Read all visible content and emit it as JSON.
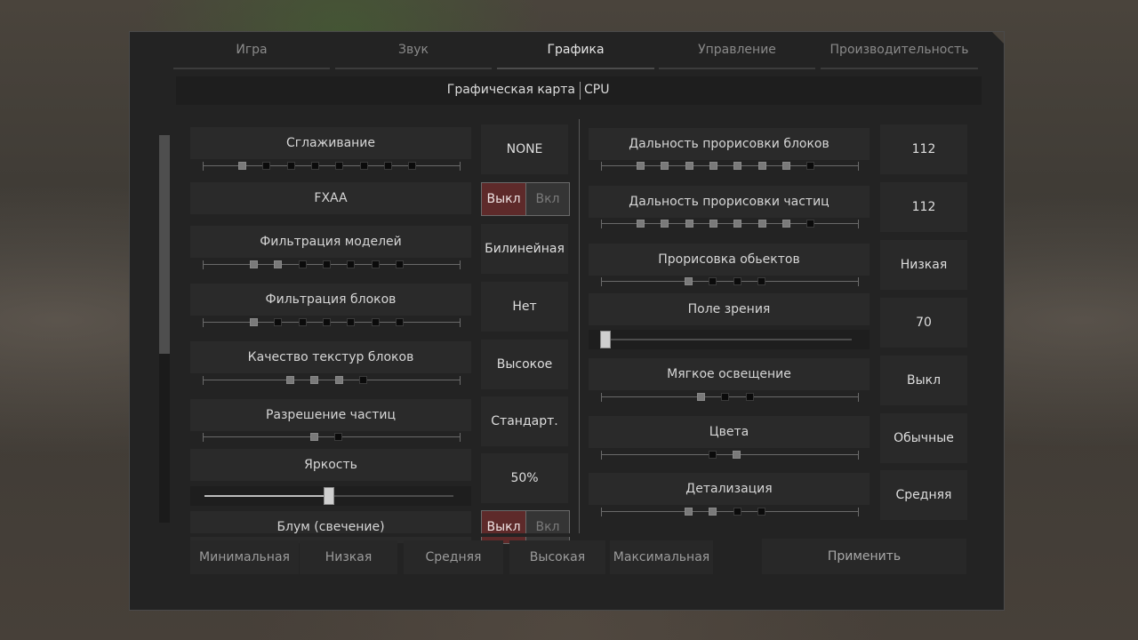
{
  "tabs": [
    {
      "label": "Игра",
      "active": false
    },
    {
      "label": "Звук",
      "active": false
    },
    {
      "label": "Графика",
      "active": true
    },
    {
      "label": "Управление",
      "active": false
    },
    {
      "label": "Производительность",
      "active": false
    }
  ],
  "subtabs": {
    "left": "Графическая карта",
    "right": "CPU"
  },
  "left": {
    "antialiasing": {
      "label": "Сглаживание",
      "value": "NONE",
      "steps": 8,
      "level": 1
    },
    "fxaa": {
      "label": "FXAA",
      "off_label": "Выкл",
      "on_label": "Вкл",
      "state": "off"
    },
    "model_filtering": {
      "label": "Фильтрация моделей",
      "value": "Билинейная",
      "steps": 7,
      "level": 2
    },
    "block_filtering": {
      "label": "Фильтрация блоков",
      "value": "Нет",
      "steps": 7,
      "level": 1
    },
    "texture_quality": {
      "label": "Качество текстур блоков",
      "value": "Высокое",
      "steps": 4,
      "level": 3
    },
    "particle_resolution": {
      "label": "Разрешение частиц",
      "value": "Стандарт.",
      "steps": 2,
      "level": 1
    },
    "brightness": {
      "label": "Яркость",
      "value": "50%",
      "fraction": 0.5
    },
    "bloom": {
      "label": "Блум (свечение)",
      "off_label": "Выкл",
      "on_label": "Вкл",
      "state": "off"
    }
  },
  "right": {
    "block_render_distance": {
      "label": "Дальность прорисовки блоков",
      "value": "112",
      "steps": 8,
      "level": 7
    },
    "particle_render_distance": {
      "label": "Дальность прорисовки частиц",
      "value": "112",
      "steps": 8,
      "level": 7
    },
    "object_render": {
      "label": "Прорисовка обьектов",
      "value": "Низкая",
      "steps": 4,
      "level": 1
    },
    "fov": {
      "label": "Поле зрения",
      "value": "70",
      "fraction": 0.0
    },
    "soft_lighting": {
      "label": "Мягкое освещение",
      "value": "Выкл",
      "steps": 3,
      "level": 1
    },
    "colors": {
      "label": "Цвета",
      "value": "Обычные",
      "steps": 2,
      "on_index": 1
    },
    "detail": {
      "label": "Детализация",
      "value": "Средняя",
      "steps": 4,
      "level": 2
    }
  },
  "presets": [
    "Минимальная",
    "Низкая",
    "Средняя",
    "Высокая",
    "Максимальная"
  ],
  "apply_label": "Применить",
  "colors_hex": {
    "panel": "#232323",
    "toggle_off": "#5e2a2a",
    "dot_on": "#7a7a7a",
    "dot_off": "#0b0b0b"
  }
}
